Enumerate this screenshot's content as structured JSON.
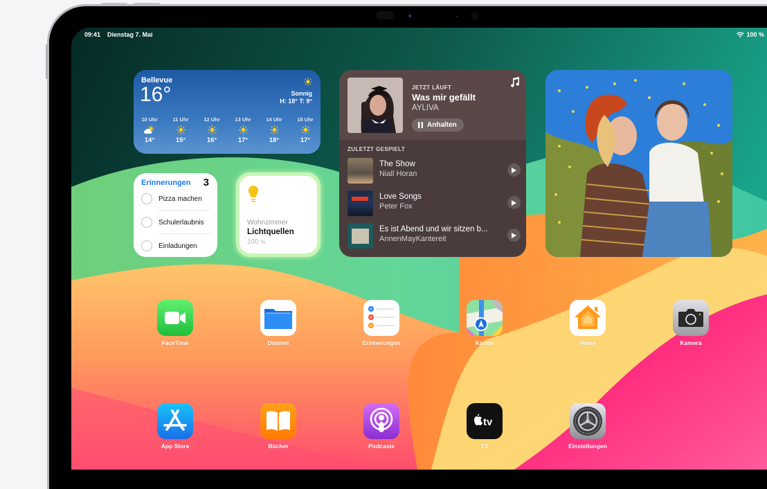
{
  "status_bar": {
    "time": "09:41",
    "date": "Dienstag 7. Mai",
    "battery": "100 %",
    "wifi_icon": "wifi-icon"
  },
  "weather": {
    "city": "Bellevue",
    "temperature": "16°",
    "condition": "Sonnig",
    "high_low": "H: 18° T: 9°",
    "hourly": [
      {
        "hour": "10 Uhr",
        "icon": "partly-cloudy-icon",
        "temp": "14°"
      },
      {
        "hour": "11 Uhr",
        "icon": "sun-icon",
        "temp": "15°"
      },
      {
        "hour": "12 Uhr",
        "icon": "sun-icon",
        "temp": "16°"
      },
      {
        "hour": "13 Uhr",
        "icon": "sun-icon",
        "temp": "17°"
      },
      {
        "hour": "14 Uhr",
        "icon": "sun-icon",
        "temp": "18°"
      },
      {
        "hour": "15 Uhr",
        "icon": "sun-icon",
        "temp": "17°"
      }
    ]
  },
  "reminders": {
    "title": "Erinnerungen",
    "count": "3",
    "items": [
      "Pizza machen",
      "Schulerlaubnis",
      "Einladungen"
    ]
  },
  "home_lights": {
    "room": "Wohnzimmer",
    "name": "Lichtquellen",
    "brightness": "100",
    "brightness_unit": "%"
  },
  "music": {
    "now_playing_label": "JETZT LÄUFT",
    "song": "Was mir gefällt",
    "artist": "AYLIVA",
    "pause_label": "Anhalten",
    "recent_label": "ZULETZT GESPIELT",
    "recent": [
      {
        "title": "The Show",
        "artist": "Niall Horan"
      },
      {
        "title": "Love Songs",
        "artist": "Peter Fox"
      },
      {
        "title": "Es ist Abend und wir sitzen b...",
        "artist": "AnnenMayKantereit"
      }
    ]
  },
  "apps": [
    {
      "label": "FaceTime",
      "icon": "facetime-icon"
    },
    {
      "label": "Dateien",
      "icon": "files-icon"
    },
    {
      "label": "Erinnerungen",
      "icon": "reminders-icon"
    },
    {
      "label": "Karten",
      "icon": "maps-icon"
    },
    {
      "label": "Home",
      "icon": "home-icon"
    },
    {
      "label": "Kamera",
      "icon": "camera-icon"
    },
    {
      "label": "App Store",
      "icon": "app-store-icon"
    },
    {
      "label": "Bücher",
      "icon": "books-icon"
    },
    {
      "label": "Podcasts",
      "icon": "podcasts-icon"
    },
    {
      "label": "TV",
      "icon": "apple-tv-icon"
    },
    {
      "label": "Einstellungen",
      "icon": "settings-icon"
    }
  ],
  "colors": {
    "reminders_accent": "#1a7cf5",
    "weather_bg": "#2f6bb5",
    "music_bg": "#4a3c3c",
    "bulb": "#f7c21a"
  }
}
